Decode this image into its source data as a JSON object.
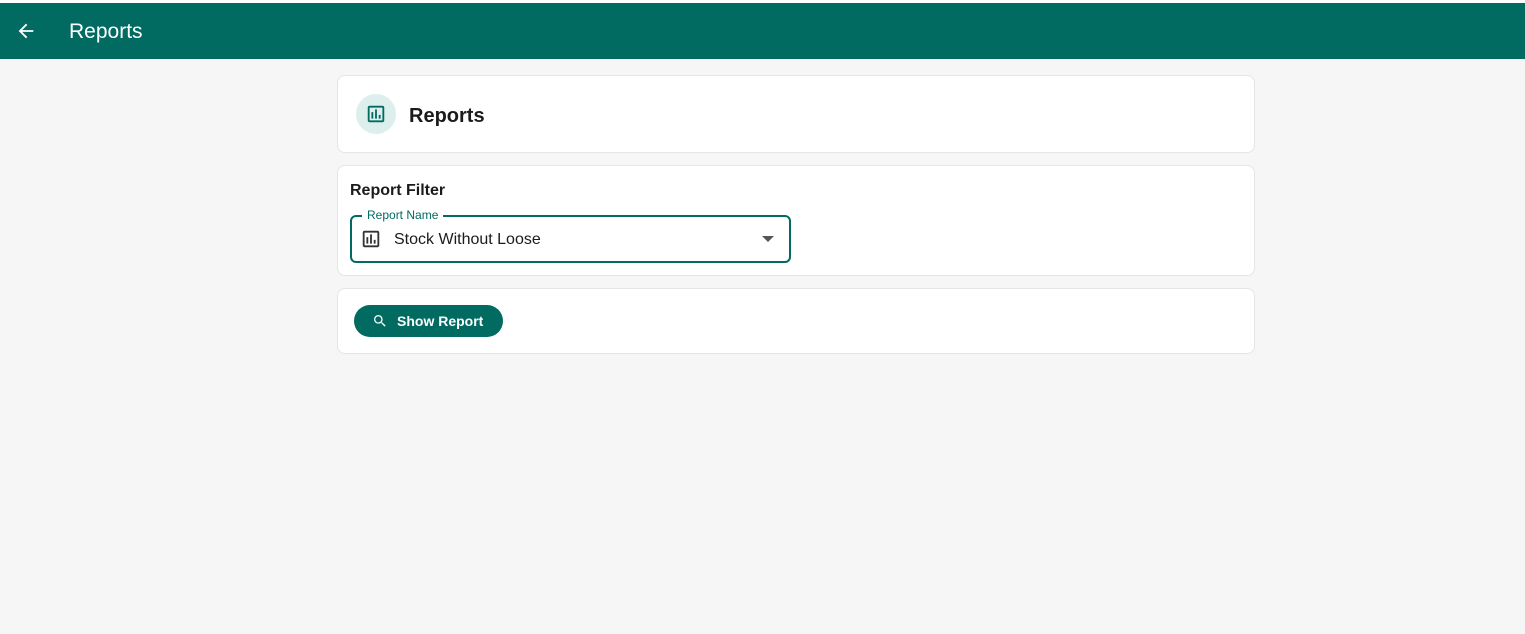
{
  "appbar": {
    "title": "Reports",
    "back_icon": "arrow-left-icon",
    "background": "#016a61"
  },
  "header_card": {
    "title": "Reports",
    "icon": "bar-chart-icon"
  },
  "filter_card": {
    "title": "Report Filter",
    "report_name": {
      "label": "Report Name",
      "value": "Stock Without Loose",
      "icon": "bar-chart-icon"
    }
  },
  "actions": {
    "show_report_label": "Show Report",
    "icon": "search-icon"
  },
  "colors": {
    "primary": "#016a61",
    "badge_bg": "#dcefed",
    "page_bg": "#f5f6f5"
  }
}
